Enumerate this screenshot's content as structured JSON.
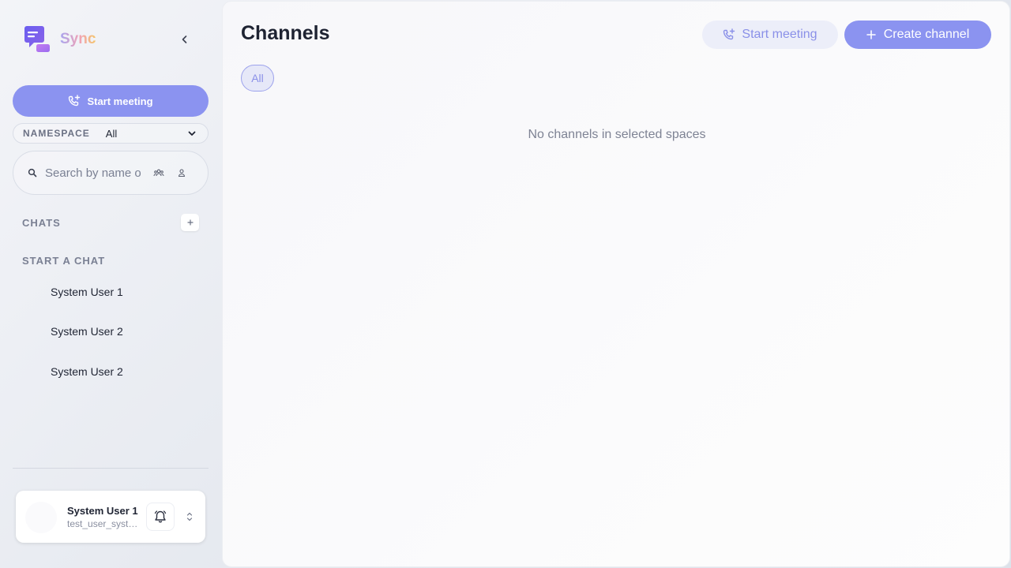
{
  "app": {
    "name": "Sync",
    "accent": "#8b93f0"
  },
  "sidebar": {
    "start_meeting_label": "Start meeting",
    "namespace": {
      "label": "NAMESPACE",
      "value": "All"
    },
    "search": {
      "placeholder": "Search by name o"
    },
    "chats": {
      "title": "CHATS"
    },
    "start_chat": {
      "title": "START A CHAT",
      "users": [
        "System User 1",
        "System User 2",
        "System User 2"
      ]
    },
    "profile": {
      "name": "System User 1",
      "handle": "test_user_system_1"
    }
  },
  "main": {
    "title": "Channels",
    "start_meeting_label": "Start meeting",
    "create_channel_label": "Create channel",
    "filters": [
      "All"
    ],
    "empty_message": "No channels in selected spaces"
  },
  "icons": [
    "chat-logo-icon",
    "chevron-left-icon",
    "phone-plus-icon",
    "chevron-down-icon",
    "search-icon",
    "group-icon",
    "person-icon",
    "plus-icon",
    "bell-icon",
    "chevrons-updown-icon"
  ]
}
